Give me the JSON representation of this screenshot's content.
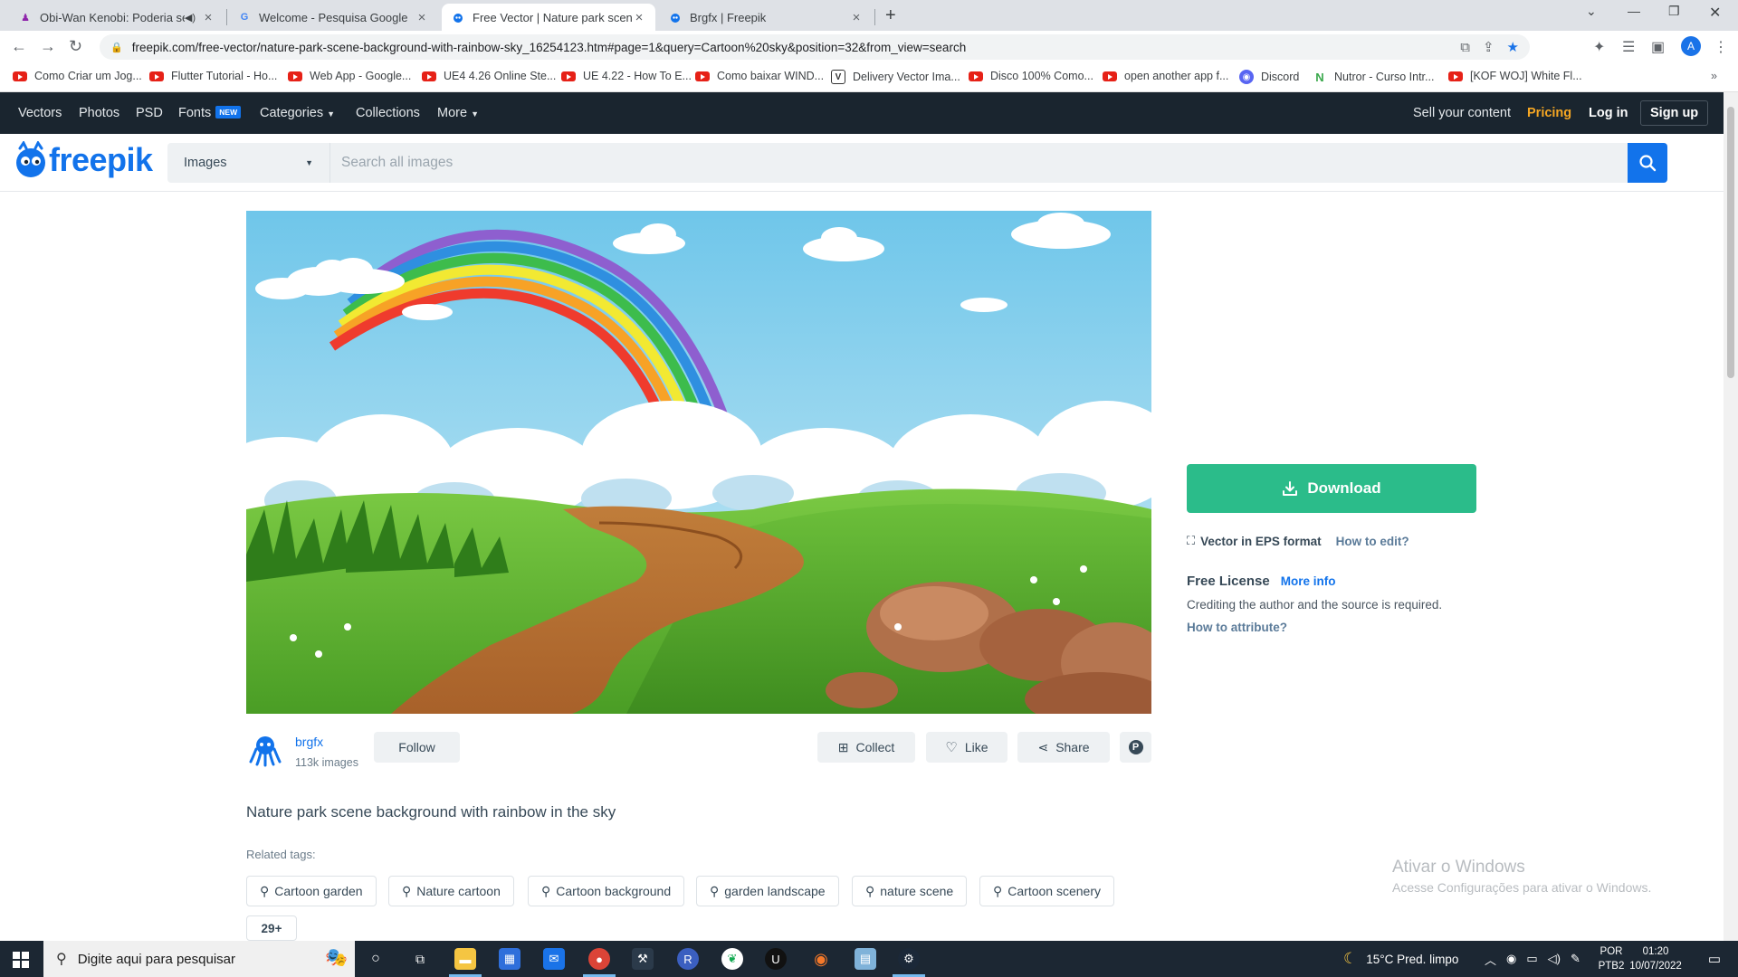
{
  "browser": {
    "tabs": [
      {
        "title": "Obi-Wan Kenobi: Poderia ser",
        "active": false
      },
      {
        "title": "Welcome - Pesquisa Google",
        "active": false
      },
      {
        "title": "Free Vector | Nature park scene b",
        "active": true
      },
      {
        "title": "Brgfx | Freepik",
        "active": false
      }
    ],
    "url": "freepik.com/free-vector/nature-park-scene-background-with-rainbow-sky_16254123.htm#page=1&query=Cartoon%20sky&position=32&from_view=search",
    "profile_initial": "A",
    "bookmarks": [
      {
        "label": "Como Criar um Jog...",
        "icon": "youtube-icon"
      },
      {
        "label": "Flutter Tutorial - Ho...",
        "icon": "youtube-icon"
      },
      {
        "label": "Web App - Google...",
        "icon": "youtube-icon"
      },
      {
        "label": "UE4 4.26 Online Ste...",
        "icon": "youtube-icon"
      },
      {
        "label": "UE 4.22 - How To E...",
        "icon": "youtube-icon"
      },
      {
        "label": "Como baixar WIND...",
        "icon": "youtube-icon"
      },
      {
        "label": "Delivery Vector Ima...",
        "icon": "vector-icon"
      },
      {
        "label": "Disco 100% Como...",
        "icon": "youtube-icon"
      },
      {
        "label": "open another app f...",
        "icon": "youtube-icon"
      },
      {
        "label": "Discord",
        "icon": "discord-icon"
      },
      {
        "label": "Nutror - Curso Intr...",
        "icon": "nutror-icon"
      },
      {
        "label": "[KOF WOJ] White Fl...",
        "icon": "youtube-icon"
      }
    ]
  },
  "site_nav": {
    "items": [
      "Vectors",
      "Photos",
      "PSD",
      "Fonts",
      "Categories",
      "Collections",
      "More"
    ],
    "fonts_badge": "NEW",
    "sell": "Sell your content",
    "pricing": "Pricing",
    "login": "Log in",
    "signup": "Sign up"
  },
  "brand": {
    "name": "freepik",
    "color": "#1273eb"
  },
  "search": {
    "type": "Images",
    "placeholder": "Search all images"
  },
  "resource": {
    "title": "Nature park scene background with rainbow in the sky",
    "author": "brgfx",
    "author_count": "113k images",
    "follow": "Follow",
    "collect": "Collect",
    "like": "Like",
    "share": "Share"
  },
  "panel": {
    "download": "Download",
    "format": "Vector in EPS format",
    "how_to_edit": "How to edit?",
    "license_title": "Free License",
    "more_info": "More info",
    "license_text": "Crediting the author and the source is required.",
    "how_to_attribute": "How to attribute?",
    "download_color": "#2bbc8a"
  },
  "related": {
    "label": "Related tags:",
    "tags": [
      "Cartoon garden",
      "Nature cartoon",
      "Cartoon background",
      "garden landscape",
      "nature scene",
      "Cartoon scenery"
    ],
    "more": "29+"
  },
  "watermark": {
    "line1": "Ativar o Windows",
    "line2": "Acesse Configurações para ativar o Windows."
  },
  "taskbar": {
    "search_placeholder": "Digite aqui para pesquisar",
    "weather": "15°C  Pred. limpo",
    "lang1": "POR",
    "lang2": "PTB2",
    "time": "01:20",
    "date": "10/07/2022"
  }
}
